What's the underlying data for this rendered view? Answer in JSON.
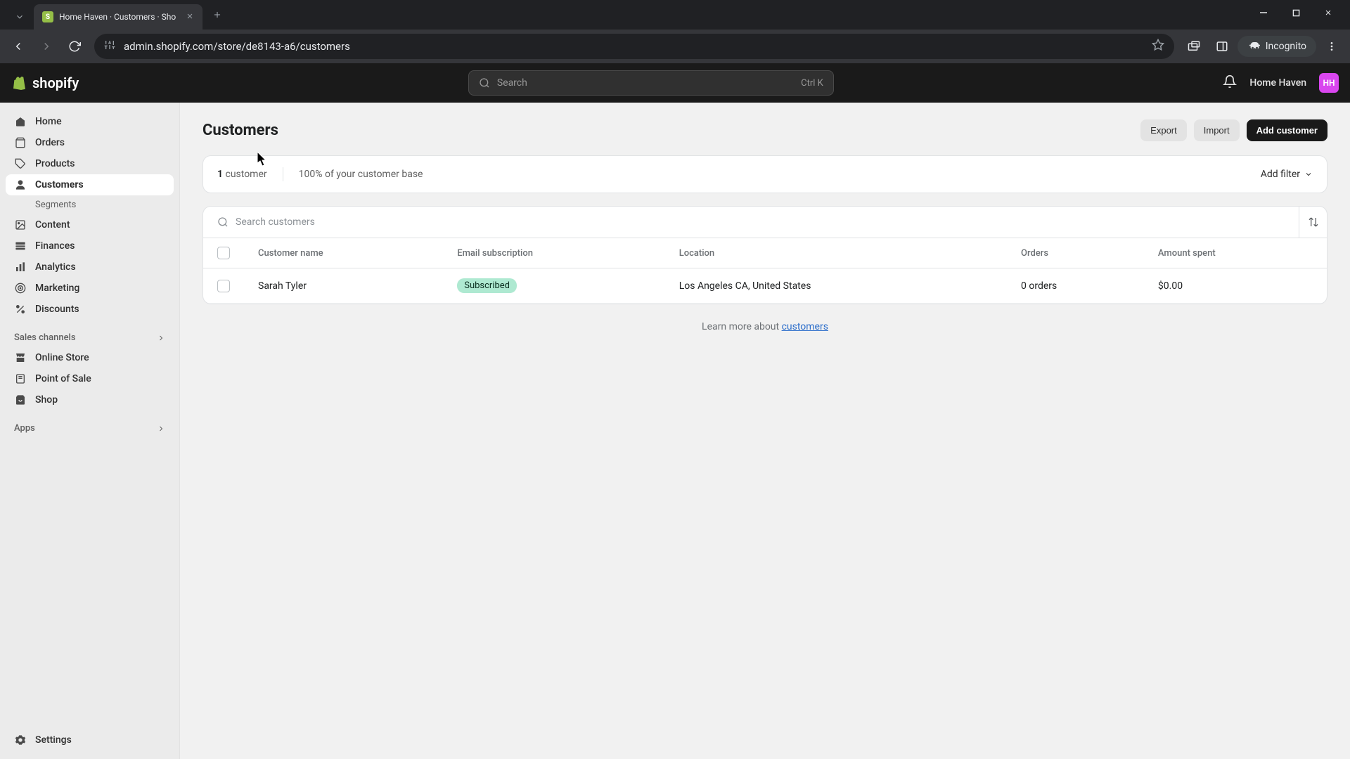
{
  "browser": {
    "tab_title": "Home Haven · Customers · Sho",
    "url": "admin.shopify.com/store/de8143-a6/customers",
    "incognito_label": "Incognito"
  },
  "header": {
    "logo_text": "shopify",
    "search_placeholder": "Search",
    "search_kbd": "Ctrl K",
    "store_name": "Home Haven",
    "avatar_initials": "HH"
  },
  "sidebar": {
    "items": [
      {
        "label": "Home",
        "icon": "home-icon"
      },
      {
        "label": "Orders",
        "icon": "orders-icon"
      },
      {
        "label": "Products",
        "icon": "products-icon"
      },
      {
        "label": "Customers",
        "icon": "customers-icon"
      },
      {
        "label": "Content",
        "icon": "content-icon"
      },
      {
        "label": "Finances",
        "icon": "finances-icon"
      },
      {
        "label": "Analytics",
        "icon": "analytics-icon"
      },
      {
        "label": "Marketing",
        "icon": "marketing-icon"
      },
      {
        "label": "Discounts",
        "icon": "discounts-icon"
      }
    ],
    "customers_sub": "Segments",
    "sales_channels_label": "Sales channels",
    "sales_channels": [
      {
        "label": "Online Store"
      },
      {
        "label": "Point of Sale"
      },
      {
        "label": "Shop"
      }
    ],
    "apps_label": "Apps",
    "settings_label": "Settings"
  },
  "page": {
    "title": "Customers",
    "actions": {
      "export": "Export",
      "import": "Import",
      "add": "Add customer"
    },
    "filter_bar": {
      "count_num": "1",
      "count_label": "customer",
      "base_pct": "100% of your customer base",
      "add_filter": "Add filter"
    },
    "search_placeholder": "Search customers",
    "columns": {
      "name": "Customer name",
      "email": "Email subscription",
      "location": "Location",
      "orders": "Orders",
      "spent": "Amount spent"
    },
    "rows": [
      {
        "name": "Sarah Tyler",
        "subscription_badge": "Subscribed",
        "location": "Los Angeles CA, United States",
        "orders": "0 orders",
        "spent": "$0.00"
      }
    ],
    "footer_prefix": "Learn more about ",
    "footer_link": "customers"
  }
}
